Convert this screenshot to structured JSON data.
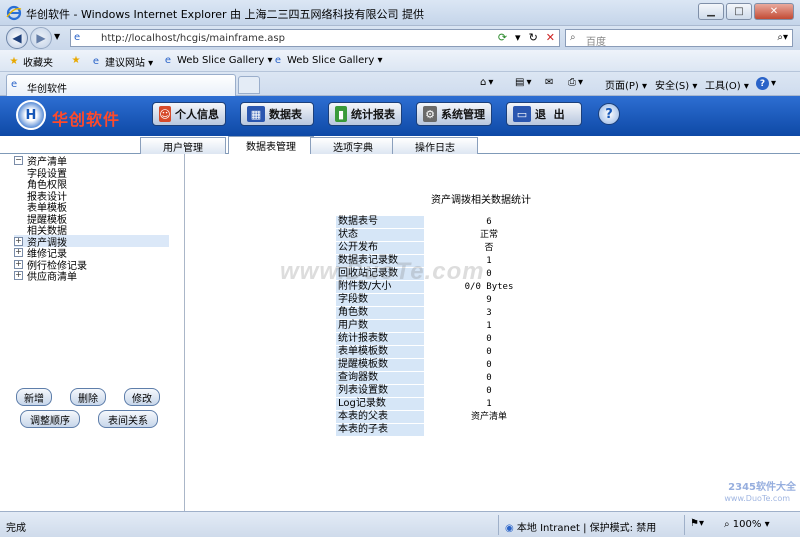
{
  "window": {
    "title": "华创软件 - Windows Internet Explorer 由 上海二三四五网络科技有限公司 提供"
  },
  "address": {
    "url": "http://localhost/hcgis/mainframe.asp",
    "search_placeholder": "百度"
  },
  "favorites": {
    "label": "收藏夹",
    "items": [
      {
        "label": "建议网站 ▾"
      },
      {
        "label": "Web Slice Gallery ▾"
      },
      {
        "label": "Web Slice Gallery ▾"
      }
    ]
  },
  "tabs": {
    "page_tab": "华创软件"
  },
  "commands": {
    "page": "页面(P) ▾",
    "safety": "安全(S) ▾",
    "tools": "工具(O) ▾",
    "help": "?"
  },
  "app": {
    "logo_text": "H",
    "brand": "华创软件",
    "buttons": [
      {
        "label": "个人信息",
        "icon": "user-icon"
      },
      {
        "label": "数据表",
        "icon": "table-icon"
      },
      {
        "label": "统计报表",
        "icon": "chart-icon"
      },
      {
        "label": "系统管理",
        "icon": "gear-icon"
      },
      {
        "label": "退  出",
        "icon": "exit-icon"
      }
    ],
    "help": "?"
  },
  "subtabs": [
    {
      "label": "用户管理",
      "active": false
    },
    {
      "label": "数据表管理",
      "active": true
    },
    {
      "label": "选项字典",
      "active": false
    },
    {
      "label": "操作日志",
      "active": false
    }
  ],
  "tree": [
    {
      "label": "资产清单",
      "expander": "−",
      "level": 0
    },
    {
      "label": "字段设置",
      "level": 1
    },
    {
      "label": "角色权限",
      "level": 1
    },
    {
      "label": "报表设计",
      "level": 1
    },
    {
      "label": "表单模板",
      "level": 1
    },
    {
      "label": "提醒模板",
      "level": 1
    },
    {
      "label": "相关数据",
      "level": 1
    },
    {
      "label": "资产调拨",
      "expander": "+",
      "level": 0,
      "selected": true
    },
    {
      "label": "维修记录",
      "expander": "+",
      "level": 0
    },
    {
      "label": "例行检修记录",
      "expander": "+",
      "level": 0
    },
    {
      "label": "供应商清单",
      "expander": "+",
      "level": 0
    }
  ],
  "left_buttons": {
    "add": "新增",
    "delete": "删除",
    "edit": "修改",
    "reorder": "调整顺序",
    "relations": "表间关系"
  },
  "stats": {
    "title": "资产调拨相关数据统计",
    "rows": [
      {
        "key": "数据表号",
        "value": "6"
      },
      {
        "key": "状态",
        "value": "正常"
      },
      {
        "key": "公开发布",
        "value": "否"
      },
      {
        "key": "数据表记录数",
        "value": "1"
      },
      {
        "key": "回收站记录数",
        "value": "0"
      },
      {
        "key": "附件数/大小",
        "value": "0/0 Bytes"
      },
      {
        "key": "字段数",
        "value": "9"
      },
      {
        "key": "角色数",
        "value": "3"
      },
      {
        "key": "用户数",
        "value": "1"
      },
      {
        "key": "统计报表数",
        "value": "0"
      },
      {
        "key": "表单模板数",
        "value": "0"
      },
      {
        "key": "提醒模板数",
        "value": "0"
      },
      {
        "key": "查询器数",
        "value": "0"
      },
      {
        "key": "列表设置数",
        "value": "0"
      },
      {
        "key": "Log记录数",
        "value": "1"
      },
      {
        "key": "本表的父表",
        "value": "资产清单"
      },
      {
        "key": "本表的子表",
        "value": ""
      }
    ]
  },
  "watermark": "www.DuoTe.com",
  "corner_watermark": "2345软件大全",
  "corner_watermark_url": "www.DuoTe.com",
  "status": {
    "text": "完成",
    "zone": "本地 Intranet | 保护模式: 禁用",
    "zoom": "100%"
  }
}
